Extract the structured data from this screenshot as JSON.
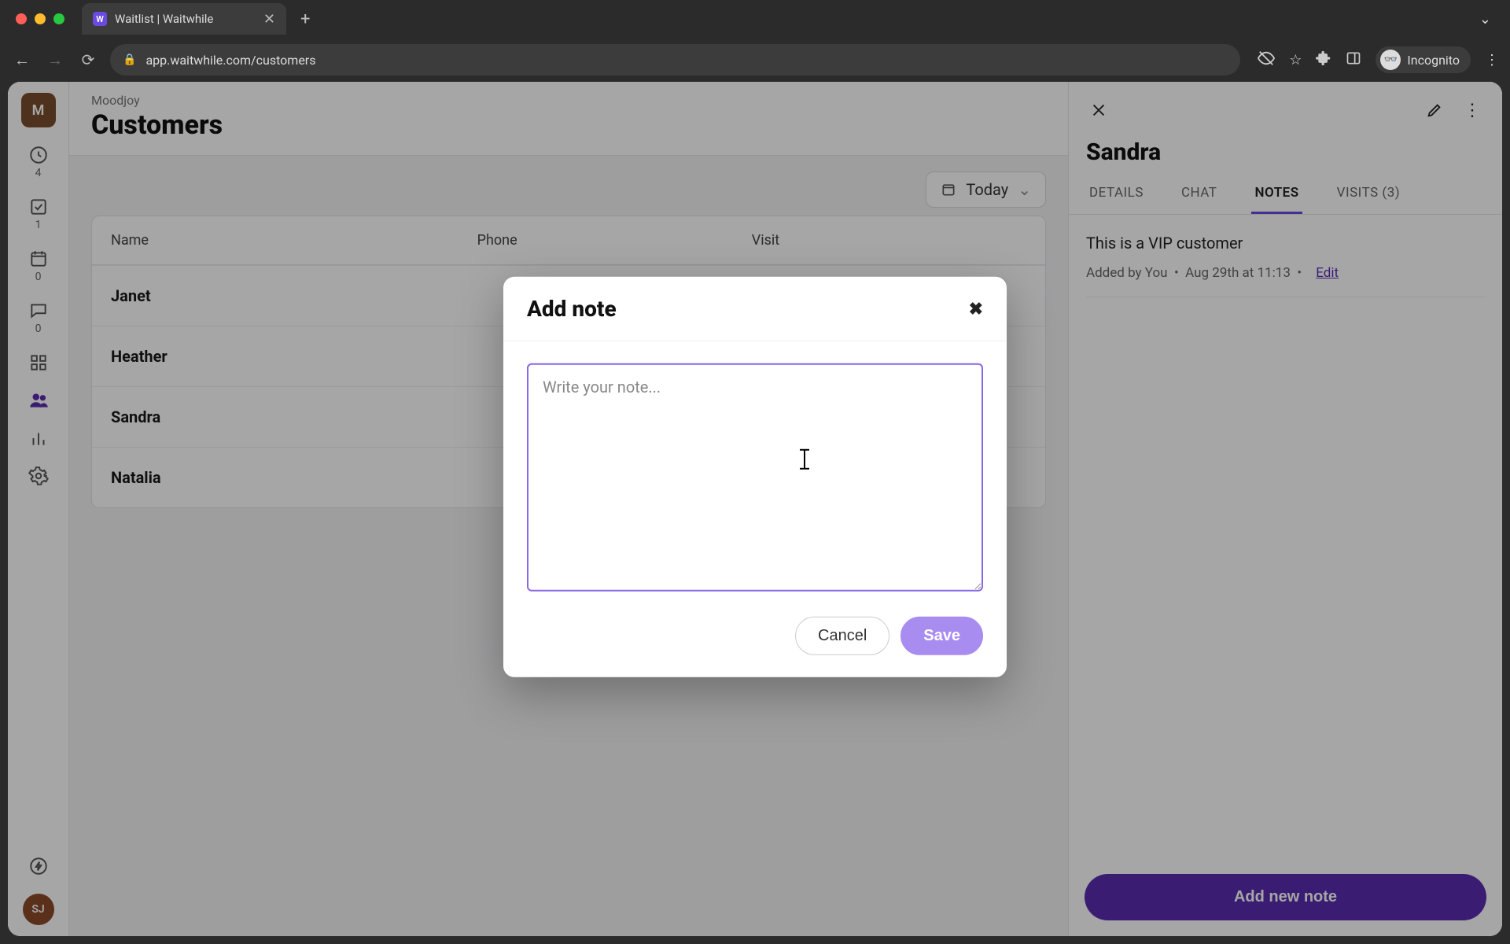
{
  "browser": {
    "tab_title": "Waitlist | Waitwhile",
    "tab_favicon_letter": "W",
    "url": "app.waitwhile.com/customers",
    "incognito_label": "Incognito"
  },
  "left_rail": {
    "org_initial": "M",
    "user_initials": "SJ",
    "counts": {
      "waitlist": "4",
      "bookings": "1",
      "calendar": "0",
      "messages": "0"
    }
  },
  "header": {
    "crumb": "Moodjoy",
    "title": "Customers"
  },
  "toolbar": {
    "date_label": "Today"
  },
  "table": {
    "columns": {
      "c0": "Name",
      "c1": "Phone",
      "c2": "Visit"
    },
    "rows": [
      {
        "name": "Janet"
      },
      {
        "name": "Heather"
      },
      {
        "name": "Sandra"
      },
      {
        "name": "Natalia"
      }
    ]
  },
  "drawer": {
    "title": "Sandra",
    "tabs": {
      "details": "DETAILS",
      "chat": "CHAT",
      "notes": "NOTES",
      "visits": "VISITS (3)"
    },
    "note_text": "This is a VIP customer",
    "note_meta_prefix": "Added by You",
    "note_meta_time": "Aug 29th at 11:13",
    "edit_label": "Edit",
    "add_button": "Add new note"
  },
  "modal": {
    "title": "Add note",
    "placeholder": "Write your note...",
    "cancel": "Cancel",
    "save": "Save"
  }
}
